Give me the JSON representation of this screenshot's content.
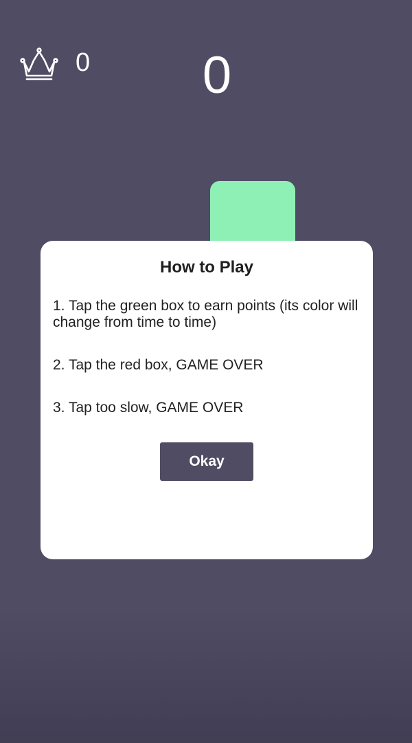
{
  "hud": {
    "best_score": "0",
    "current_score": "0",
    "crown_icon": "crown-icon"
  },
  "target": {
    "color": "#8ff0b6"
  },
  "dialog": {
    "title": "How to Play",
    "rules": [
      "1. Tap the green box to earn points (its color will change from time to time)",
      "2. Tap the red box, GAME OVER",
      "3. Tap too slow, GAME OVER"
    ],
    "okay_label": "Okay",
    "button_color": "#4f4c64"
  }
}
